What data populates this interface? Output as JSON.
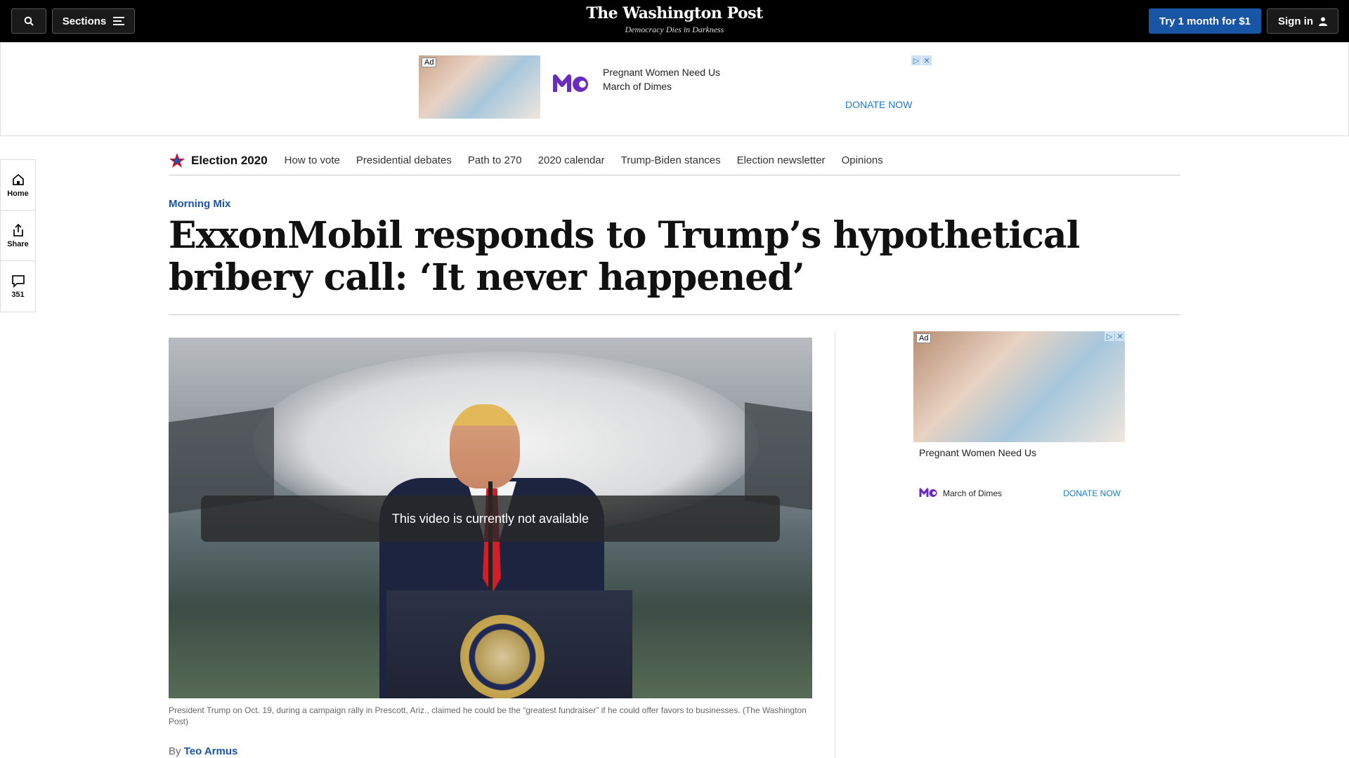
{
  "topbar": {
    "sections_label": "Sections",
    "logo_title": "The Washington Post",
    "logo_tagline": "Democracy Dies in Darkness",
    "subscribe_label": "Try 1 month for $1",
    "signin_label": "Sign in"
  },
  "top_ad": {
    "badge": "Ad",
    "line1": "Pregnant Women Need Us",
    "line2": "March of Dimes",
    "cta": "DONATE NOW"
  },
  "nav": {
    "title": "Election 2020",
    "items": [
      "How to vote",
      "Presidential debates",
      "Path to 270",
      "2020 calendar",
      "Trump-Biden stances",
      "Election newsletter",
      "Opinions"
    ]
  },
  "rail": {
    "home": "Home",
    "share": "Share",
    "comments": "351"
  },
  "article": {
    "kicker": "Morning Mix",
    "headline": "ExxonMobil responds to Trump’s hypothetical bribery call: ‘It never happened’",
    "video_message": "This video is currently not available",
    "caption": "President Trump on Oct. 19, during a campaign rally in Prescott, Ariz., claimed he could be the “greatest fundraiser” if he could offer favors to businesses. (The Washington Post)",
    "byline_prefix": "By",
    "author": "Teo Armus"
  },
  "side_ad": {
    "badge": "Ad",
    "line1": "Pregnant Women Need Us",
    "brand": "March of Dimes",
    "cta": "DONATE NOW"
  },
  "colors": {
    "accent_blue": "#1955a5",
    "ad_link": "#1f7ac8",
    "topbar_bg": "#000000"
  }
}
